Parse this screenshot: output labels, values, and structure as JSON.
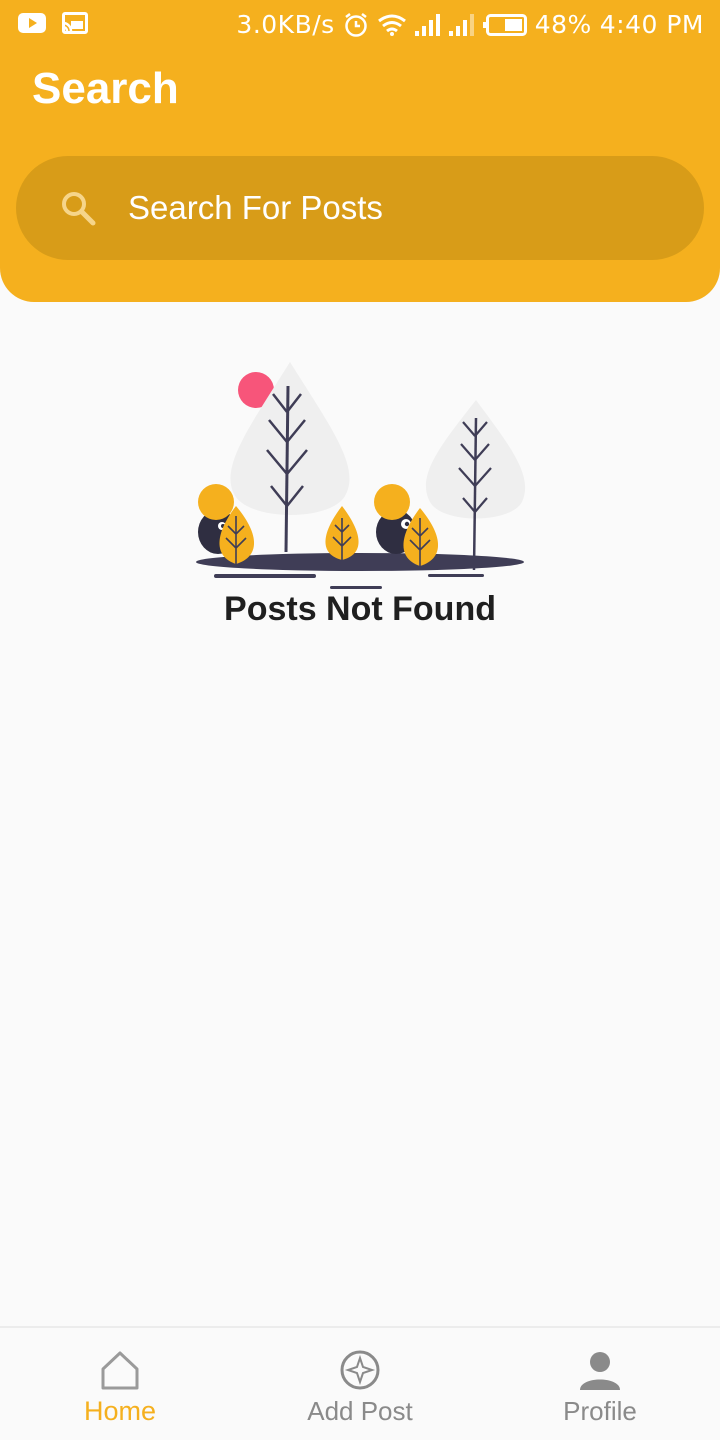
{
  "status_bar": {
    "speed": "3.0KB/s",
    "battery": "48%",
    "time": "4:40 PM",
    "icons": [
      "youtube-icon",
      "cast-icon",
      "alarm-icon",
      "wifi-icon",
      "signal-icon",
      "signal-icon",
      "battery-icon"
    ]
  },
  "header": {
    "title": "Search"
  },
  "search": {
    "placeholder": "Search For Posts",
    "value": ""
  },
  "empty_state": {
    "message": "Posts Not Found"
  },
  "bottom_nav": {
    "items": [
      {
        "label": "Home",
        "icon": "home-icon",
        "active": true
      },
      {
        "label": "Add Post",
        "icon": "add-post-icon",
        "active": false
      },
      {
        "label": "Profile",
        "icon": "profile-icon",
        "active": false
      }
    ]
  },
  "colors": {
    "primary": "#f5b01e",
    "search_bg": "#d89c18",
    "background": "#fafafa",
    "inactive": "#8a8a8a"
  }
}
